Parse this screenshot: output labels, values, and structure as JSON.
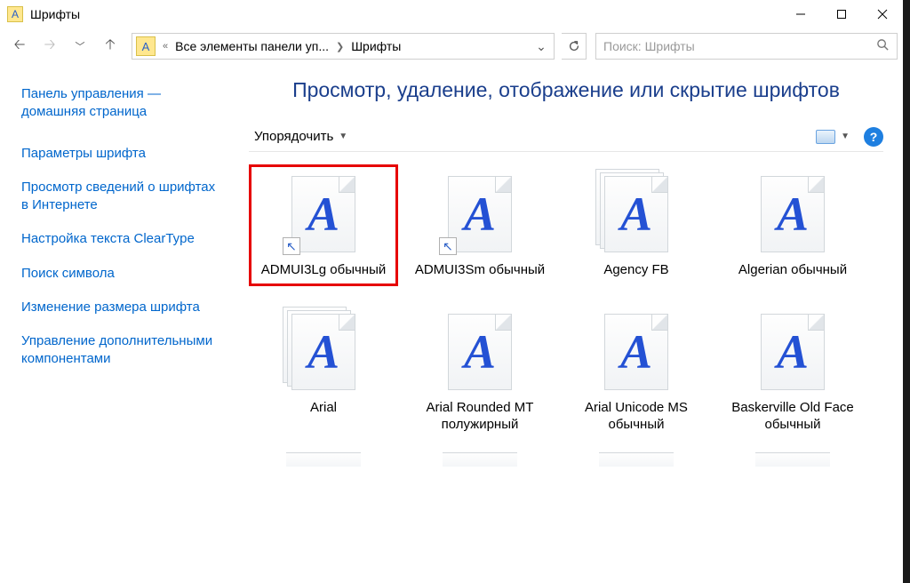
{
  "titlebar": {
    "title": "Шрифты"
  },
  "nav": {
    "breadcrumb_prefix": "«",
    "breadcrumb_1": "Все элементы панели уп...",
    "breadcrumb_2": "Шрифты"
  },
  "search": {
    "placeholder": "Поиск: Шрифты"
  },
  "sidebar": {
    "home": "Панель управления — домашняя страница",
    "links": [
      "Параметры шрифта",
      "Просмотр сведений о шрифтах в Интернете",
      "Настройка текста ClearType",
      "Поиск символа",
      "Изменение размера шрифта",
      "Управление дополнительными компонентами"
    ]
  },
  "main": {
    "title": "Просмотр, удаление, отображение или скрытие шрифтов",
    "toolbar": {
      "organize": "Упорядочить"
    }
  },
  "fonts": [
    {
      "name": "ADMUI3Lg обычный",
      "multi": false,
      "shortcut": true
    },
    {
      "name": "ADMUI3Sm обычный",
      "multi": false,
      "shortcut": true
    },
    {
      "name": "Agency FB",
      "multi": true,
      "shortcut": false
    },
    {
      "name": "Algerian обычный",
      "multi": false,
      "shortcut": false
    },
    {
      "name": "Arial",
      "multi": true,
      "shortcut": false
    },
    {
      "name": "Arial Rounded MT полужирный",
      "multi": false,
      "shortcut": false
    },
    {
      "name": "Arial Unicode MS обычный",
      "multi": false,
      "shortcut": false
    },
    {
      "name": "Baskerville Old Face обычный",
      "multi": false,
      "shortcut": false
    }
  ]
}
